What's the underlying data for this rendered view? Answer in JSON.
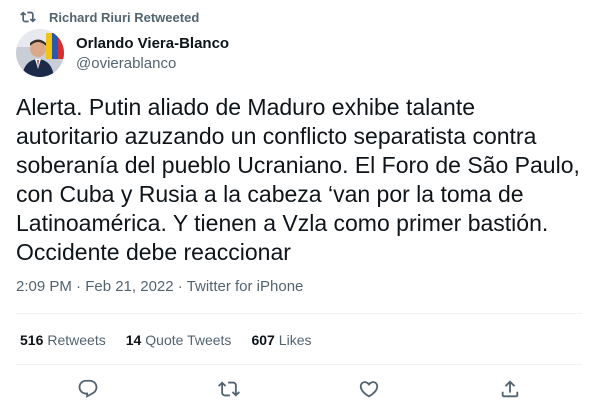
{
  "retweet": {
    "label": "Richard Riuri Retweeted",
    "icon": "retweet-icon"
  },
  "author": {
    "display_name": "Orlando Viera-Blanco",
    "handle": "@ovierablanco",
    "avatar": "avatar-photo"
  },
  "tweet": {
    "text": "Alerta. Putin aliado de Maduro exhibe talante\nautoritario azuzando un conflicto separatista contra\nsoberanía del pueblo Ucraniano. El Foro de São Paulo,\ncon Cuba y Rusia a la cabeza  ‘van por la toma de\nLatinoamérica. Y tienen a Vzla como primer bastión.\nOccidente debe reaccionar"
  },
  "meta": {
    "timestamp": "2:09 PM · Feb 21, 2022 · Twitter for iPhone"
  },
  "stats": {
    "retweets_count": "516",
    "retweets_label": "Retweets",
    "quotes_count": "14",
    "quotes_label": "Quote Tweets",
    "likes_count": "607",
    "likes_label": "Likes"
  },
  "actions": {
    "reply_icon": "reply-icon",
    "retweet_icon": "retweet-icon",
    "like_icon": "heart-icon",
    "share_icon": "share-icon"
  },
  "colors": {
    "text_primary": "#0f1419",
    "text_secondary": "#536471",
    "divider": "#eff3f4"
  }
}
